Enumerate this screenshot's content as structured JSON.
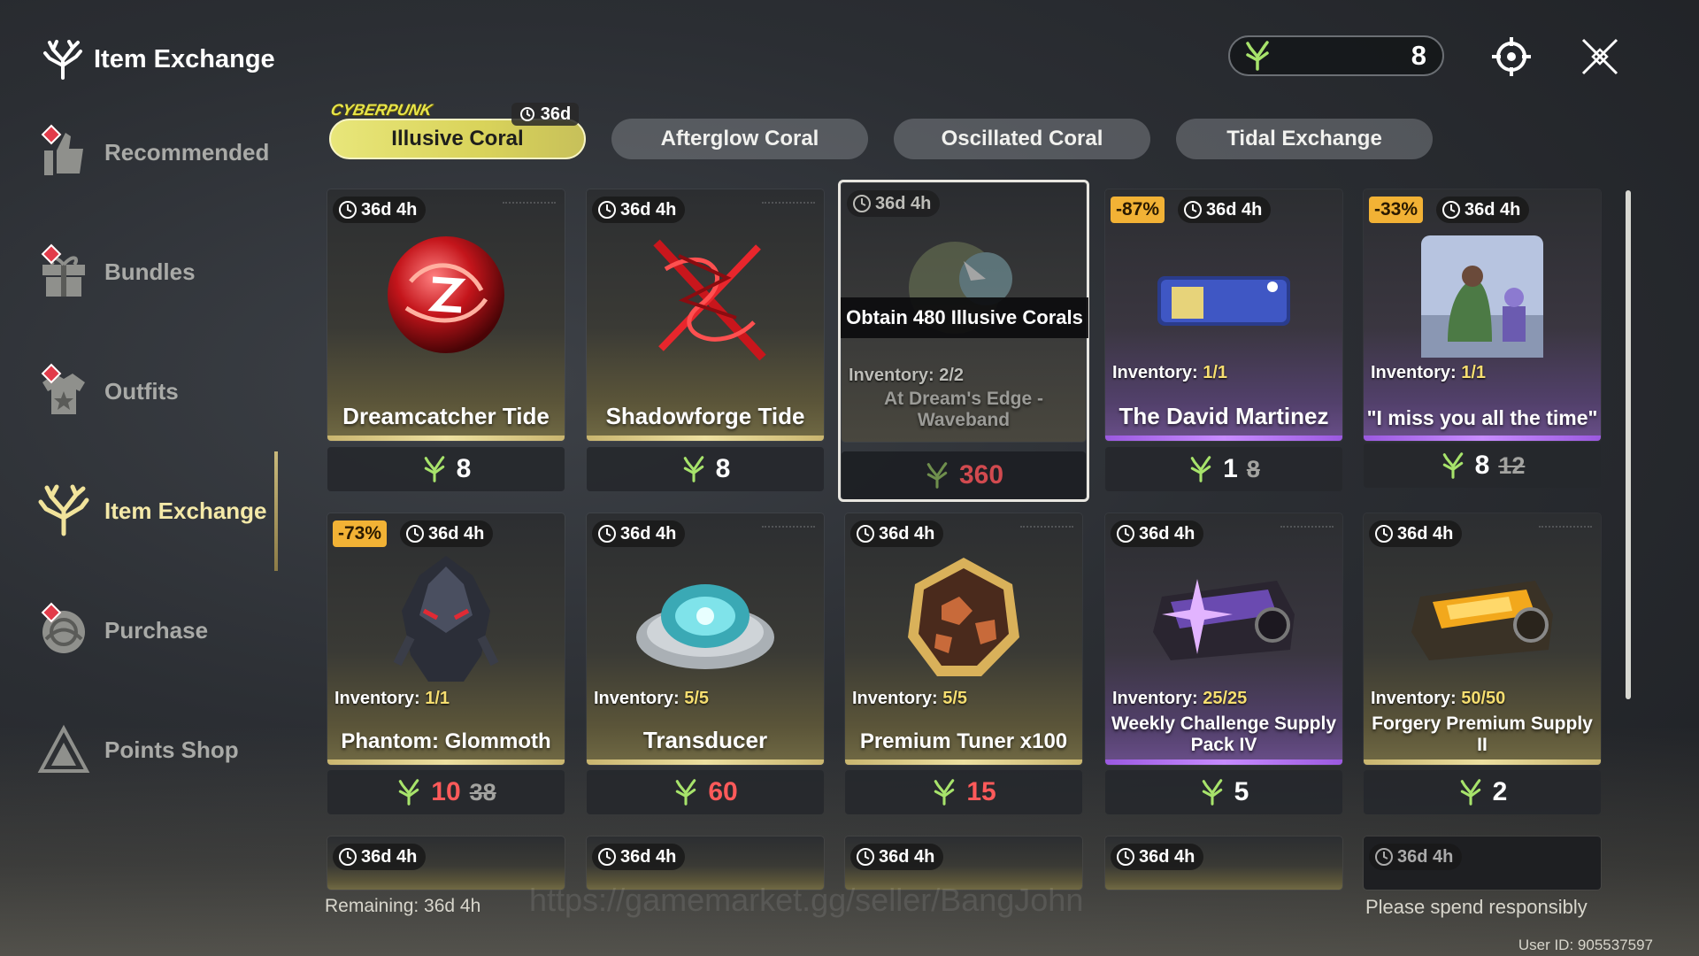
{
  "header": {
    "title": "Item Exchange",
    "currency_value": "8"
  },
  "sidebar": {
    "items": [
      {
        "label": "Recommended"
      },
      {
        "label": "Bundles"
      },
      {
        "label": "Outfits"
      },
      {
        "label": "Item Exchange"
      },
      {
        "label": "Purchase"
      },
      {
        "label": "Points Shop"
      }
    ]
  },
  "tabs": [
    {
      "label": "Illusive Coral",
      "logo": "CYBERPUNK",
      "time": "36d"
    },
    {
      "label": "Afterglow Coral"
    },
    {
      "label": "Oscillated Coral"
    },
    {
      "label": "Tidal Exchange"
    }
  ],
  "cards": [
    {
      "time": "36d 4h",
      "name": "Dreamcatcher Tide",
      "price": "8"
    },
    {
      "time": "36d 4h",
      "name": "Shadowforge Tide",
      "price": "8"
    },
    {
      "time": "36d 4h",
      "tooltip": "Obtain 480 Illusive Corals",
      "inventory_label": "Inventory:",
      "inventory": "2/2",
      "name_line1": "At Dream's Edge -",
      "name_line2": "Waveband",
      "price": "360"
    },
    {
      "discount": "-87%",
      "time": "36d 4h",
      "inventory_label": "Inventory:",
      "inventory": "1/1",
      "name": "The David Martinez",
      "price": "1",
      "old_price": "8"
    },
    {
      "discount": "-33%",
      "time": "36d 4h",
      "inventory_label": "Inventory:",
      "inventory": "1/1",
      "name": "\"I miss you all the time\"",
      "price": "8",
      "old_price": "12"
    },
    {
      "discount": "-73%",
      "time": "36d 4h",
      "inventory_label": "Inventory:",
      "inventory": "1/1",
      "name": "Phantom: Glommoth",
      "price": "10",
      "old_price": "38"
    },
    {
      "time": "36d 4h",
      "inventory_label": "Inventory:",
      "inventory": "5/5",
      "name": "Transducer",
      "price": "60"
    },
    {
      "time": "36d 4h",
      "inventory_label": "Inventory:",
      "inventory": "5/5",
      "name": "Premium Tuner x100",
      "price": "15"
    },
    {
      "time": "36d 4h",
      "inventory_label": "Inventory:",
      "inventory": "25/25",
      "name_line1": "Weekly Challenge Supply",
      "name_line2": "Pack IV",
      "price": "5"
    },
    {
      "time": "36d 4h",
      "inventory_label": "Inventory:",
      "inventory": "50/50",
      "name_line1": "Forgery Premium Supply",
      "name_line2": "II",
      "price": "2"
    },
    {
      "time": "36d 4h"
    },
    {
      "time": "36d 4h"
    },
    {
      "time": "36d 4h"
    },
    {
      "time": "36d 4h"
    },
    {
      "time": "36d 4h"
    }
  ],
  "footer": {
    "remaining": "Remaining: 36d 4h",
    "notice": "Please spend responsibly",
    "user_id": "User ID: 905537597",
    "watermark": "https://gamemarket.gg/seller/BangJohn"
  },
  "colors": {
    "accent": "#e8e67a",
    "discount": "#f2b235",
    "price_red": "#ff5a5a",
    "purple_rim": "#c88cff"
  }
}
